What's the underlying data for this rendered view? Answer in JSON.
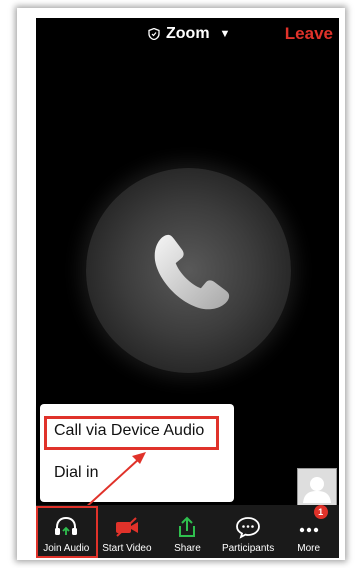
{
  "header": {
    "title": "Zoom",
    "title_icon": "shield-icon",
    "leave_label": "Leave"
  },
  "audio_menu": {
    "options": [
      {
        "label": "Call via Device Audio",
        "highlighted": true
      },
      {
        "label": "Dial in",
        "highlighted": false
      }
    ]
  },
  "toolbar": {
    "items": [
      {
        "label": "Join Audio",
        "icon": "headphones-icon"
      },
      {
        "label": "Start Video",
        "icon": "video-off-icon"
      },
      {
        "label": "Share",
        "icon": "share-icon"
      },
      {
        "label": "Participants",
        "icon": "chat-bubble-icon"
      },
      {
        "label": "More",
        "icon": "more-icon",
        "badge": "1"
      }
    ]
  },
  "colors": {
    "accent_red": "#e0322a",
    "share_green": "#2fbf4e",
    "background": "#000000"
  }
}
